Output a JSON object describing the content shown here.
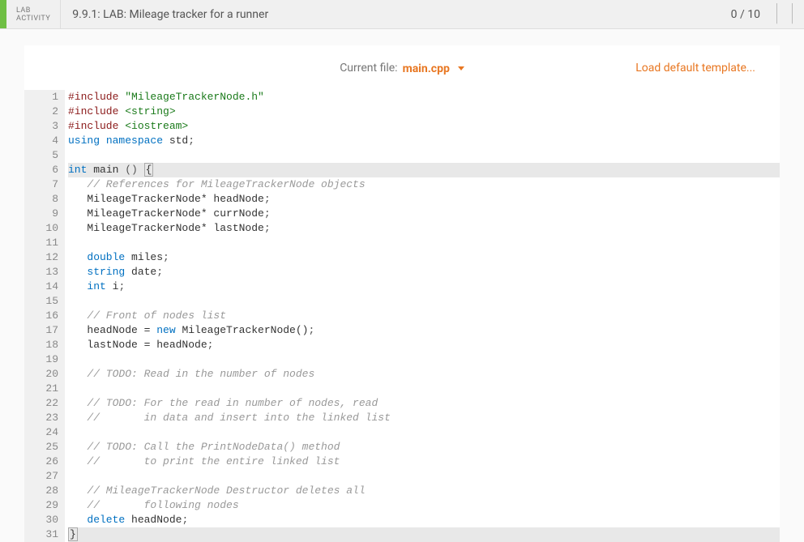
{
  "header": {
    "lab_label_line1": "LAB",
    "lab_label_line2": "ACTIVITY",
    "title": "9.9.1: LAB: Mileage tracker for a runner",
    "score": "0 / 10"
  },
  "editor_header": {
    "current_file_label": "Current file:",
    "current_file_name": "main.cpp",
    "load_default": "Load default template..."
  },
  "code": {
    "lines": [
      {
        "n": 1,
        "hl": false,
        "tokens": [
          [
            "preproc",
            "#include "
          ],
          [
            "string",
            "\"MileageTrackerNode.h\""
          ]
        ]
      },
      {
        "n": 2,
        "hl": false,
        "tokens": [
          [
            "preproc",
            "#include "
          ],
          [
            "string",
            "<string>"
          ]
        ]
      },
      {
        "n": 3,
        "hl": false,
        "tokens": [
          [
            "preproc",
            "#include "
          ],
          [
            "string",
            "<iostream>"
          ]
        ]
      },
      {
        "n": 4,
        "hl": false,
        "tokens": [
          [
            "keyword",
            "using "
          ],
          [
            "keyword",
            "namespace "
          ],
          [
            "ident",
            "std"
          ],
          [
            "punc",
            ";"
          ]
        ]
      },
      {
        "n": 5,
        "hl": false,
        "tokens": []
      },
      {
        "n": 6,
        "hl": true,
        "tokens": [
          [
            "type",
            "int "
          ],
          [
            "func",
            "main "
          ],
          [
            "punc",
            "() "
          ],
          [
            "bracket",
            "{"
          ]
        ]
      },
      {
        "n": 7,
        "hl": false,
        "tokens": [
          [
            "ident",
            "   "
          ],
          [
            "comment",
            "// References for MileageTrackerNode objects"
          ]
        ]
      },
      {
        "n": 8,
        "hl": false,
        "tokens": [
          [
            "ident",
            "   MileageTrackerNode* headNode"
          ],
          [
            "punc",
            ";"
          ]
        ]
      },
      {
        "n": 9,
        "hl": false,
        "tokens": [
          [
            "ident",
            "   MileageTrackerNode* currNode"
          ],
          [
            "punc",
            ";"
          ]
        ]
      },
      {
        "n": 10,
        "hl": false,
        "tokens": [
          [
            "ident",
            "   MileageTrackerNode* lastNode"
          ],
          [
            "punc",
            ";"
          ]
        ]
      },
      {
        "n": 11,
        "hl": false,
        "tokens": []
      },
      {
        "n": 12,
        "hl": false,
        "tokens": [
          [
            "ident",
            "   "
          ],
          [
            "type",
            "double "
          ],
          [
            "ident",
            "miles"
          ],
          [
            "punc",
            ";"
          ]
        ]
      },
      {
        "n": 13,
        "hl": false,
        "tokens": [
          [
            "ident",
            "   "
          ],
          [
            "type",
            "string "
          ],
          [
            "ident",
            "date"
          ],
          [
            "punc",
            ";"
          ]
        ]
      },
      {
        "n": 14,
        "hl": false,
        "tokens": [
          [
            "ident",
            "   "
          ],
          [
            "type",
            "int "
          ],
          [
            "ident",
            "i"
          ],
          [
            "punc",
            ";"
          ]
        ]
      },
      {
        "n": 15,
        "hl": false,
        "tokens": []
      },
      {
        "n": 16,
        "hl": false,
        "tokens": [
          [
            "ident",
            "   "
          ],
          [
            "comment",
            "// Front of nodes list"
          ]
        ]
      },
      {
        "n": 17,
        "hl": false,
        "tokens": [
          [
            "ident",
            "   headNode = "
          ],
          [
            "keyword",
            "new "
          ],
          [
            "ident",
            "MileageTrackerNode()"
          ],
          [
            "punc",
            ";"
          ]
        ]
      },
      {
        "n": 18,
        "hl": false,
        "tokens": [
          [
            "ident",
            "   lastNode = headNode"
          ],
          [
            "punc",
            ";"
          ]
        ]
      },
      {
        "n": 19,
        "hl": false,
        "tokens": []
      },
      {
        "n": 20,
        "hl": false,
        "tokens": [
          [
            "ident",
            "   "
          ],
          [
            "comment",
            "// TODO: Read in the number of nodes"
          ]
        ]
      },
      {
        "n": 21,
        "hl": false,
        "tokens": []
      },
      {
        "n": 22,
        "hl": false,
        "tokens": [
          [
            "ident",
            "   "
          ],
          [
            "comment",
            "// TODO: For the read in number of nodes, read"
          ]
        ]
      },
      {
        "n": 23,
        "hl": false,
        "tokens": [
          [
            "ident",
            "   "
          ],
          [
            "comment",
            "//       in data and insert into the linked list"
          ]
        ]
      },
      {
        "n": 24,
        "hl": false,
        "tokens": []
      },
      {
        "n": 25,
        "hl": false,
        "tokens": [
          [
            "ident",
            "   "
          ],
          [
            "comment",
            "// TODO: Call the PrintNodeData() method"
          ]
        ]
      },
      {
        "n": 26,
        "hl": false,
        "tokens": [
          [
            "ident",
            "   "
          ],
          [
            "comment",
            "//       to print the entire linked list"
          ]
        ]
      },
      {
        "n": 27,
        "hl": false,
        "tokens": []
      },
      {
        "n": 28,
        "hl": false,
        "tokens": [
          [
            "ident",
            "   "
          ],
          [
            "comment",
            "// MileageTrackerNode Destructor deletes all"
          ]
        ]
      },
      {
        "n": 29,
        "hl": false,
        "tokens": [
          [
            "ident",
            "   "
          ],
          [
            "comment",
            "//       following nodes"
          ]
        ]
      },
      {
        "n": 30,
        "hl": false,
        "tokens": [
          [
            "ident",
            "   "
          ],
          [
            "keyword",
            "delete "
          ],
          [
            "ident",
            "headNode"
          ],
          [
            "punc",
            ";"
          ]
        ]
      },
      {
        "n": 31,
        "hl": true,
        "tokens": [
          [
            "bracket",
            "}"
          ]
        ]
      }
    ]
  }
}
